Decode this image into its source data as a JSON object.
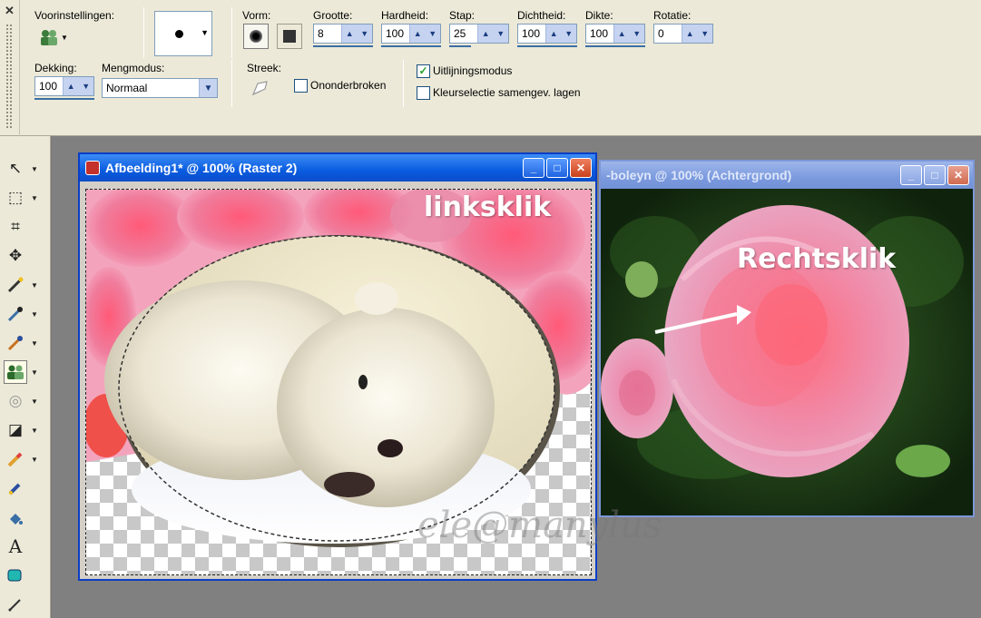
{
  "toolbar": {
    "presets_label": "Voorinstellingen:",
    "shape_label": "Vorm:",
    "size_label": "Grootte:",
    "size_value": "8",
    "hardness_label": "Hardheid:",
    "hardness_value": "100",
    "step_label": "Stap:",
    "step_value": "25",
    "density_label": "Dichtheid:",
    "density_value": "100",
    "thickness_label": "Dikte:",
    "thickness_value": "100",
    "rotation_label": "Rotatie:",
    "rotation_value": "0",
    "opacity_label": "Dekking:",
    "opacity_value": "100",
    "blend_label": "Mengmodus:",
    "blend_value": "Normaal",
    "stroke_label": "Streek:",
    "continuous_label": "Ononderbroken",
    "continuous_checked": false,
    "align_label": "Uitlijningsmodus",
    "align_checked": true,
    "colorsel_label": "Kleurselectie samengev. lagen",
    "colorsel_checked": false
  },
  "tools": [
    {
      "name": "pick-tool",
      "glyph": "↖",
      "has_more": true
    },
    {
      "name": "selection-tool",
      "glyph": "⬚",
      "has_more": true
    },
    {
      "name": "crop-tool",
      "glyph": "⌗",
      "has_more": false
    },
    {
      "name": "move-tool",
      "glyph": "✥",
      "has_more": false
    },
    {
      "name": "magic-wand-tool",
      "glyph": "⁄",
      "has_more": true
    },
    {
      "name": "dropper-tool",
      "glyph": "⁄",
      "has_more": true
    },
    {
      "name": "paintbrush-tool",
      "glyph": "⁄",
      "has_more": true
    },
    {
      "name": "clone-brush-tool",
      "glyph": "⚇",
      "has_more": true,
      "active": true
    },
    {
      "name": "dodge-tool",
      "glyph": "◎",
      "has_more": true
    },
    {
      "name": "lighten-tool",
      "glyph": "◪",
      "has_more": true
    },
    {
      "name": "eraser-tool",
      "glyph": "⁄",
      "has_more": true
    },
    {
      "name": "picture-tube-tool",
      "glyph": "⁄",
      "has_more": false
    },
    {
      "name": "fill-tool",
      "glyph": "⁄",
      "has_more": false
    },
    {
      "name": "text-tool",
      "glyph": "A",
      "has_more": false
    },
    {
      "name": "preset-shape-tool",
      "glyph": "▰",
      "has_more": false
    },
    {
      "name": "pen-tool",
      "glyph": "✎",
      "has_more": false
    }
  ],
  "windows": {
    "main_title": "Afbeelding1* @ 100% (Raster 2)",
    "main_overlay": "linksklik",
    "second_title": "-boleyn @ 100% (Achtergrond)",
    "second_overlay": "Rechtsklik",
    "minimize_glyph": "_",
    "maximize_glyph": "□",
    "close_glyph": "✕"
  },
  "watermark": "ele@manylus",
  "colors": {
    "title_active": "#0a5ce0",
    "title_inactive": "#7b9ade",
    "toolbar_bg": "#ece9d8"
  }
}
